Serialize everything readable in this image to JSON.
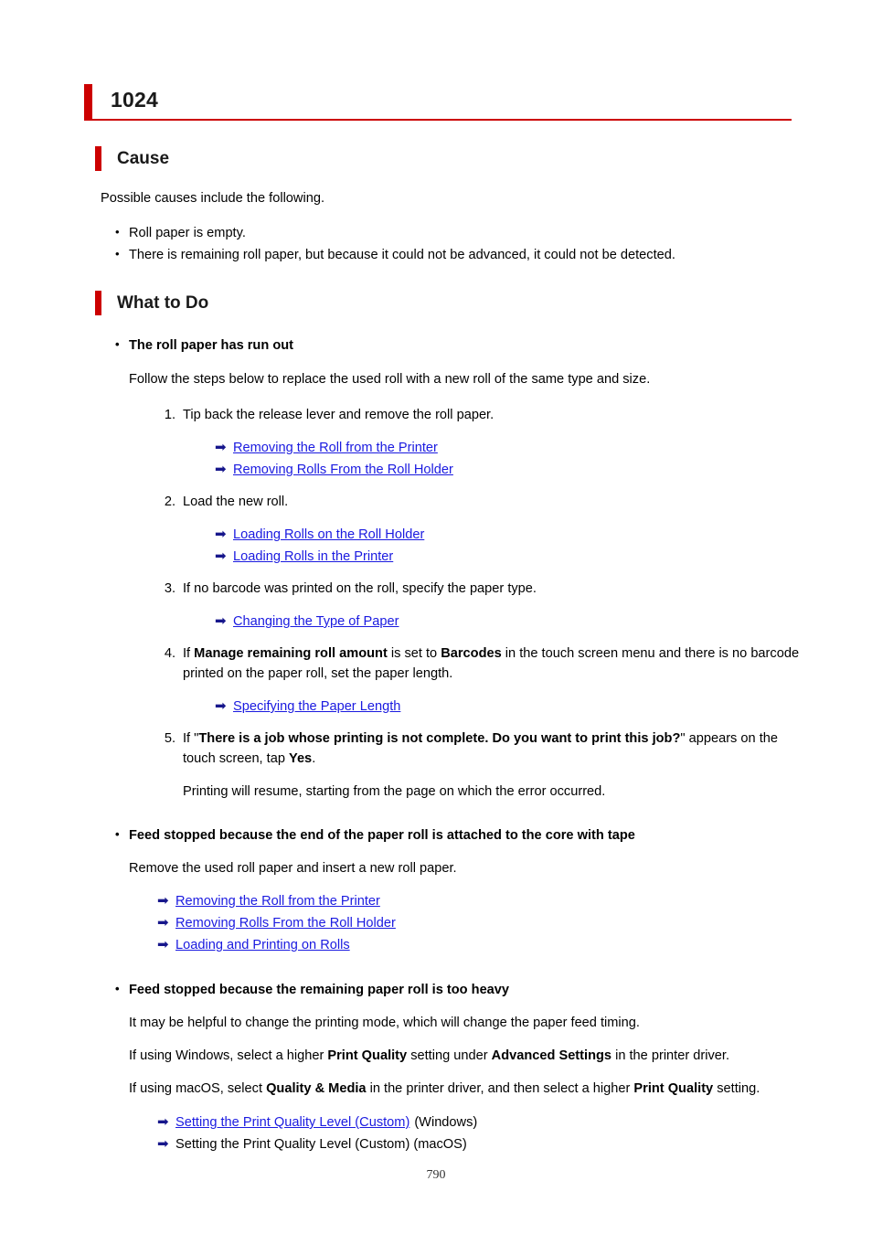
{
  "document": {
    "error_code_title": "1024",
    "page_number": "790",
    "accent_color": "#cc0000",
    "link_color": "#1a1ae0",
    "arrow_icon_color": "#17178c",
    "arrow_glyph": "➡"
  },
  "cause_section": {
    "heading": "Cause",
    "intro": "Possible causes include the following.",
    "bullets": [
      "Roll paper is empty.",
      "There is remaining roll paper, but because it could not be advanced, it could not be detected."
    ]
  },
  "what_to_do_section": {
    "heading": "What to Do",
    "topics": [
      {
        "title": "The roll paper has run out",
        "intro": "Follow the steps below to replace the used roll with a new roll of the same type and size.",
        "steps": [
          {
            "number": "1.",
            "text": "Tip back the release lever and remove the roll paper.",
            "links": [
              {
                "label": "Removing the Roll from the Printer",
                "is_link": true,
                "suffix": ""
              },
              {
                "label": "Removing Rolls From the Roll Holder",
                "is_link": true,
                "suffix": ""
              }
            ]
          },
          {
            "number": "2.",
            "text": "Load the new roll.",
            "links": [
              {
                "label": "Loading Rolls on the Roll Holder",
                "is_link": true,
                "suffix": ""
              },
              {
                "label": "Loading Rolls in the Printer",
                "is_link": true,
                "suffix": ""
              }
            ]
          },
          {
            "number": "3.",
            "text": "If no barcode was printed on the roll, specify the paper type.",
            "links": [
              {
                "label": "Changing the Type of Paper",
                "is_link": true,
                "suffix": ""
              }
            ]
          },
          {
            "number": "4.",
            "text_runs": [
              {
                "t": "If ",
                "bold": false
              },
              {
                "t": "Manage remaining roll amount",
                "bold": true
              },
              {
                "t": " is set to ",
                "bold": false
              },
              {
                "t": "Barcodes",
                "bold": true
              },
              {
                "t": " in the touch screen menu and there is no barcode printed on the paper roll, set the paper length.",
                "bold": false
              }
            ],
            "links": [
              {
                "label": "Specifying the Paper Length",
                "is_link": true,
                "suffix": ""
              }
            ]
          },
          {
            "number": "5.",
            "text_runs": [
              {
                "t": "If \"",
                "bold": false
              },
              {
                "t": "There is a job whose printing is not complete. Do you want to print this job?",
                "bold": true
              },
              {
                "t": "\" appears on the touch screen, tap ",
                "bold": false
              },
              {
                "t": "Yes",
                "bold": true
              },
              {
                "t": ".",
                "bold": false
              }
            ],
            "note": "Printing will resume, starting from the page on which the error occurred.",
            "links": []
          }
        ]
      },
      {
        "title": "Feed stopped because the end of the paper roll is attached to the core with tape",
        "intro": "Remove the used roll paper and insert a new roll paper.",
        "links": [
          {
            "label": "Removing the Roll from the Printer",
            "is_link": true,
            "suffix": ""
          },
          {
            "label": "Removing Rolls From the Roll Holder",
            "is_link": true,
            "suffix": ""
          },
          {
            "label": "Loading and Printing on Rolls",
            "is_link": true,
            "suffix": ""
          }
        ]
      },
      {
        "title": "Feed stopped because the remaining paper roll is too heavy",
        "paragraphs": [
          {
            "runs": [
              {
                "t": "It may be helpful to change the printing mode, which will change the paper feed timing.",
                "bold": false
              }
            ]
          },
          {
            "runs": [
              {
                "t": "If using Windows, select a higher ",
                "bold": false
              },
              {
                "t": "Print Quality",
                "bold": true
              },
              {
                "t": " setting under ",
                "bold": false
              },
              {
                "t": "Advanced Settings",
                "bold": true
              },
              {
                "t": " in the printer driver.",
                "bold": false
              }
            ]
          },
          {
            "runs": [
              {
                "t": "If using macOS, select ",
                "bold": false
              },
              {
                "t": "Quality & Media",
                "bold": true
              },
              {
                "t": " in the printer driver, and then select a higher ",
                "bold": false
              },
              {
                "t": "Print Quality",
                "bold": true
              },
              {
                "t": " setting.",
                "bold": false
              }
            ]
          }
        ],
        "links": [
          {
            "label": "Setting the Print Quality Level (Custom)",
            "is_link": true,
            "suffix": "(Windows)"
          },
          {
            "label": "Setting the Print Quality Level (Custom) (macOS)",
            "is_link": false,
            "suffix": ""
          }
        ]
      }
    ]
  }
}
